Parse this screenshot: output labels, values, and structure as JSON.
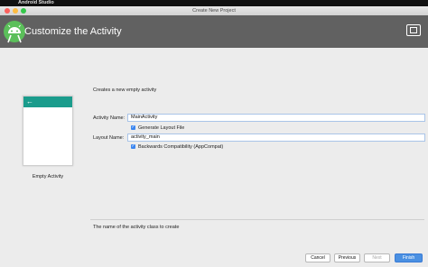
{
  "menubar": {
    "apple": "",
    "app_name": "Android Studio"
  },
  "window": {
    "title": "Create New Project"
  },
  "header": {
    "title": "Customize the Activity"
  },
  "preview": {
    "back_arrow": "←",
    "template_label": "Empty Activity"
  },
  "form": {
    "intro": "Creates a new empty activity",
    "activity_name_label": "Activity Name:",
    "activity_name_value": "MainActivity",
    "generate_layout_label": "Generate Layout File",
    "layout_name_label": "Layout Name:",
    "layout_name_value": "activity_main",
    "backwards_compat_label": "Backwards Compatibility (AppCompat)",
    "checkmark": "✓",
    "help_text": "The name of the activity class to create"
  },
  "buttons": {
    "cancel": "Cancel",
    "previous": "Previous",
    "next": "Next",
    "finish": "Finish"
  },
  "colors": {
    "accent": "#1a9c8c",
    "header": "#616161",
    "primary_button": "#4a90e2",
    "checkbox": "#3b86f0"
  },
  "icons": [
    "apple-icon",
    "android-studio-logo-icon",
    "device-preview-icon",
    "back-arrow-icon",
    "checkbox-checked-icon"
  ]
}
